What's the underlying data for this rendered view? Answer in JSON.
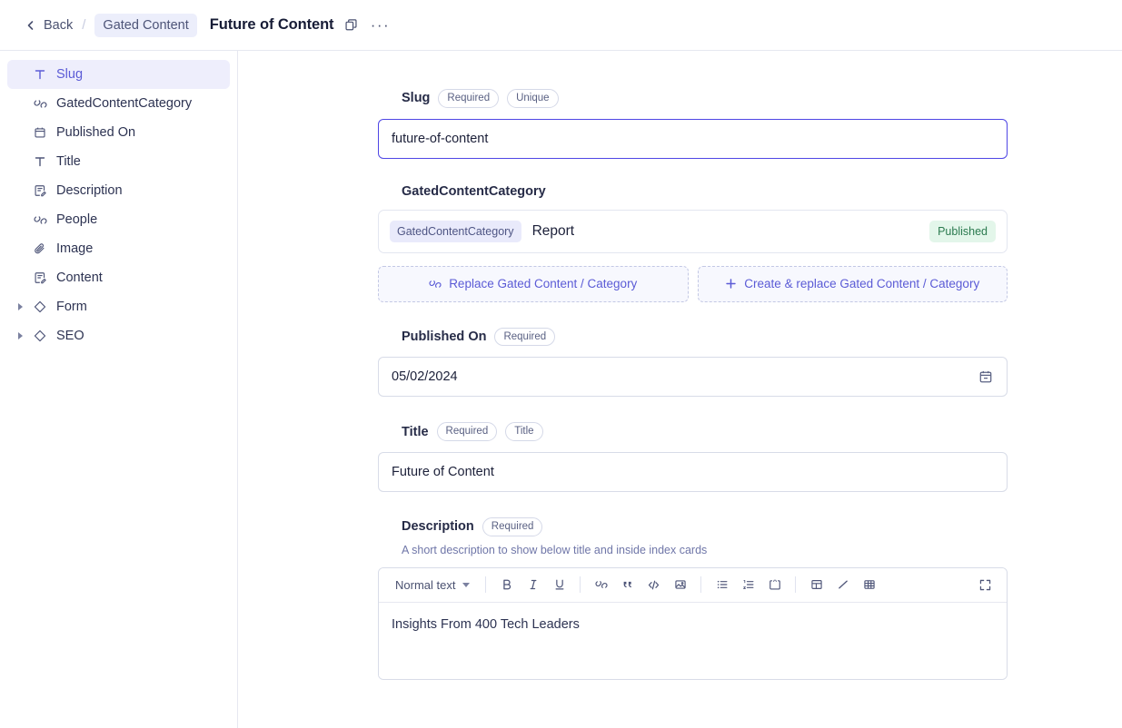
{
  "header": {
    "back_label": "Back",
    "back_icon": "chevron-left-icon",
    "separator": "/",
    "breadcrumb_chip": "Gated Content",
    "title": "Future of Content",
    "duplicate_icon": "copy-icon",
    "more_label": "···"
  },
  "sidebar": {
    "items": [
      {
        "label": "Slug",
        "icon": "text-type-icon",
        "active": true,
        "expandable": false
      },
      {
        "label": "GatedContentCategory",
        "icon": "link-icon",
        "active": false,
        "expandable": false
      },
      {
        "label": "Published On",
        "icon": "calendar-icon",
        "active": false,
        "expandable": false
      },
      {
        "label": "Title",
        "icon": "text-type-icon",
        "active": false,
        "expandable": false
      },
      {
        "label": "Description",
        "icon": "rich-text-icon",
        "active": false,
        "expandable": false
      },
      {
        "label": "People",
        "icon": "link-icon",
        "active": false,
        "expandable": false
      },
      {
        "label": "Image",
        "icon": "paperclip-icon",
        "active": false,
        "expandable": false
      },
      {
        "label": "Content",
        "icon": "rich-text-icon",
        "active": false,
        "expandable": false
      },
      {
        "label": "Form",
        "icon": "diamond-icon",
        "active": false,
        "expandable": true
      },
      {
        "label": "SEO",
        "icon": "diamond-icon",
        "active": false,
        "expandable": true
      }
    ]
  },
  "fields": {
    "slug": {
      "label": "Slug",
      "badges": [
        "Required",
        "Unique"
      ],
      "value": "future-of-content",
      "focused": true
    },
    "gated_content_category": {
      "label": "GatedContentCategory",
      "badges": [],
      "reference": {
        "type_chip": "GatedContentCategory",
        "name": "Report",
        "status": "Published"
      },
      "actions": [
        {
          "label": "Replace Gated Content / Category",
          "icon": "link-icon"
        },
        {
          "label": "Create & replace Gated Content / Category",
          "icon": "plus-icon"
        }
      ]
    },
    "published_on": {
      "label": "Published On",
      "badges": [
        "Required"
      ],
      "value": "05/02/2024",
      "icon": "calendar-icon"
    },
    "title": {
      "label": "Title",
      "badges": [
        "Required",
        "Title"
      ],
      "value": "Future of Content"
    },
    "description": {
      "label": "Description",
      "badges": [
        "Required"
      ],
      "helper": "A short description to show below title and inside index cards",
      "toolbar": {
        "style_select": "Normal text",
        "buttons": [
          {
            "name": "bold-icon",
            "glyph": "B"
          },
          {
            "name": "italic-icon",
            "glyph": "I"
          },
          {
            "name": "underline-icon",
            "glyph": "U"
          },
          {
            "name": "link-icon",
            "glyph": ""
          },
          {
            "name": "quote-icon",
            "glyph": ""
          },
          {
            "name": "code-icon",
            "glyph": ""
          },
          {
            "name": "image-icon",
            "glyph": ""
          },
          {
            "name": "bullet-list-icon",
            "glyph": ""
          },
          {
            "name": "numbered-list-icon",
            "glyph": ""
          },
          {
            "name": "code-block-icon",
            "glyph": ""
          },
          {
            "name": "layout-icon",
            "glyph": ""
          },
          {
            "name": "divider-icon",
            "glyph": ""
          },
          {
            "name": "table-icon",
            "glyph": ""
          }
        ],
        "fullscreen_icon": "fullscreen-icon"
      },
      "content": "Insights From 400 Tech Leaders"
    }
  },
  "colors": {
    "accent": "#5b5bd6",
    "accent_bg": "#eeeefc",
    "focus_border": "#4f46e5",
    "status_green_bg": "#e3f6ea",
    "status_green_text": "#2b7a4f",
    "border": "#d8dce8"
  }
}
